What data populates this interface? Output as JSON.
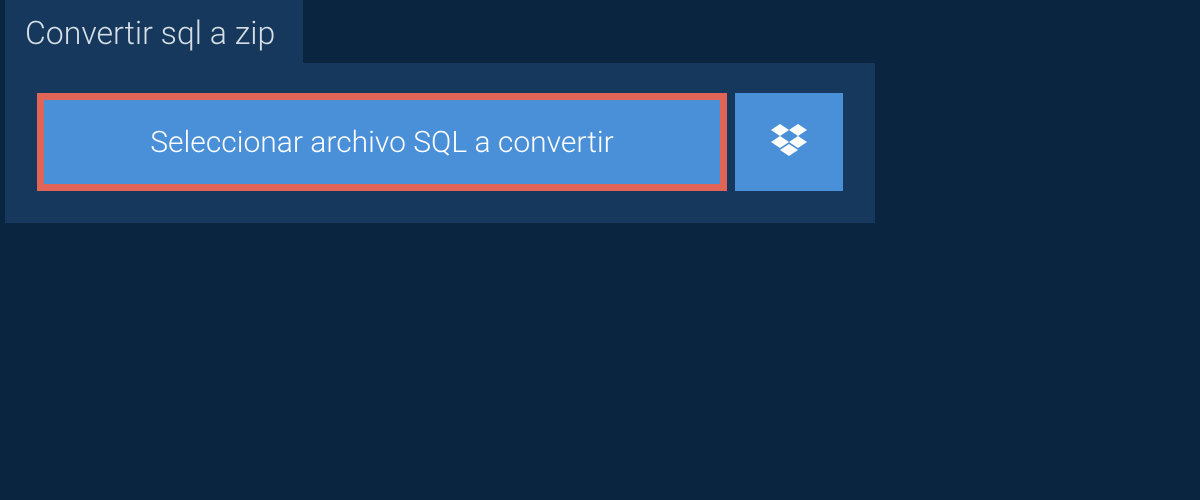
{
  "tab": {
    "title": "Convertir sql a zip"
  },
  "actions": {
    "select_file_label": "Seleccionar archivo SQL a convertir"
  },
  "colors": {
    "page_bg": "#0a2540",
    "panel_bg": "#15385c",
    "button_bg": "#4a90d9",
    "highlight_border": "#e06556",
    "text_light": "#ffffff",
    "tab_text": "#d5dde5"
  }
}
